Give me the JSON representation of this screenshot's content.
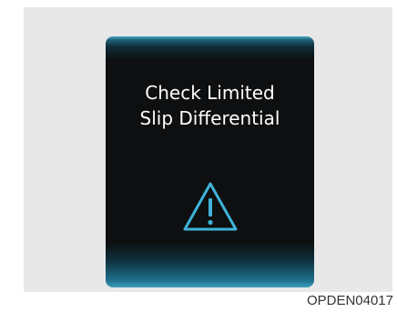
{
  "display": {
    "line1": "Check Limited",
    "line2": "Slip Differential",
    "icon": "warning-triangle-icon",
    "icon_color": "#3fb3d8",
    "text_color": "#ffffff",
    "accent": "#3d9fbd"
  },
  "caption": {
    "code": "OPDEN04017"
  }
}
